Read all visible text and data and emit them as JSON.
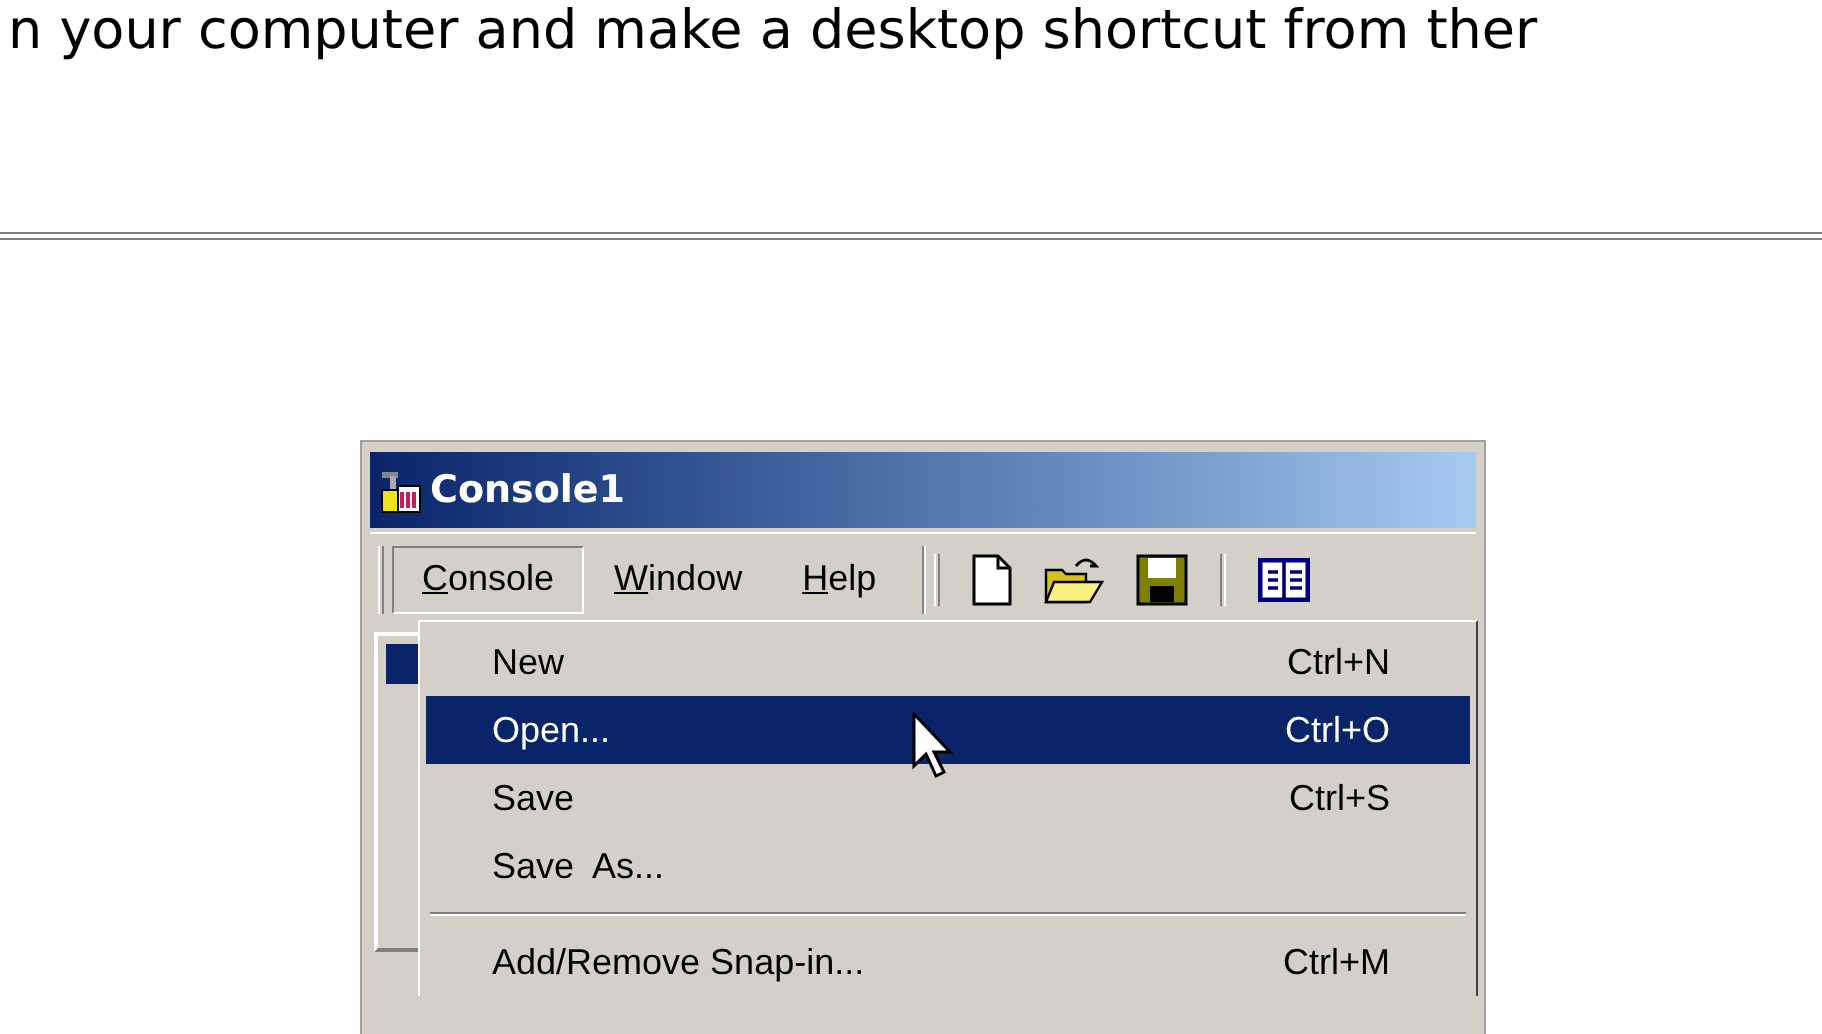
{
  "article_text": "n your computer and make a desktop shortcut from ther",
  "window": {
    "title": "Console1"
  },
  "menu_bar": [
    {
      "label": "Console",
      "selected": true
    },
    {
      "label": "Window",
      "selected": false
    },
    {
      "label": "Help",
      "selected": false
    }
  ],
  "menu": [
    {
      "kind": "item",
      "label": "New",
      "shortcut": "Ctrl+N",
      "selected": false
    },
    {
      "kind": "item",
      "label": "Open...",
      "shortcut": "Ctrl+O",
      "selected": true
    },
    {
      "kind": "item",
      "label": "Save",
      "shortcut": "Ctrl+S",
      "selected": false
    },
    {
      "kind": "item",
      "label": "Save  As...",
      "selected": false
    },
    {
      "kind": "separator"
    },
    {
      "kind": "item",
      "label": "Add/Remove Snap-in...",
      "shortcut": "Ctrl+M",
      "selected": false
    }
  ]
}
